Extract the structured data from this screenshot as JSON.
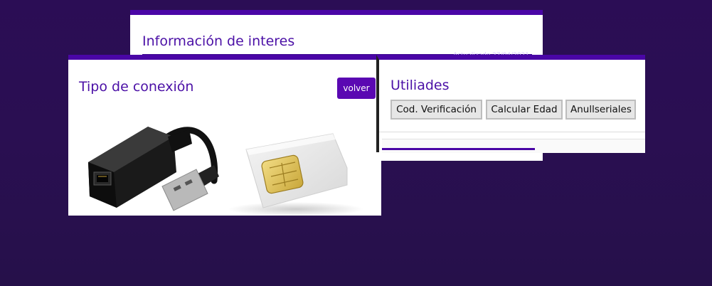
{
  "info_panel": {
    "title": "Información de interes",
    "strip_text": "Actualizado 27/04/2021"
  },
  "connection_panel": {
    "title": "Tipo de conexión",
    "back_label": "volver",
    "images": [
      "usb-ethernet-adapter",
      "sim-card"
    ]
  },
  "utilities_panel": {
    "title": "Utiliades",
    "buttons": [
      "Cod. Verificación",
      "Calcular Edad",
      "Anullseriales"
    ]
  },
  "colors": {
    "accent": "#4a06a6",
    "button_primary": "#5a08b2",
    "background": "#2b0d55"
  }
}
